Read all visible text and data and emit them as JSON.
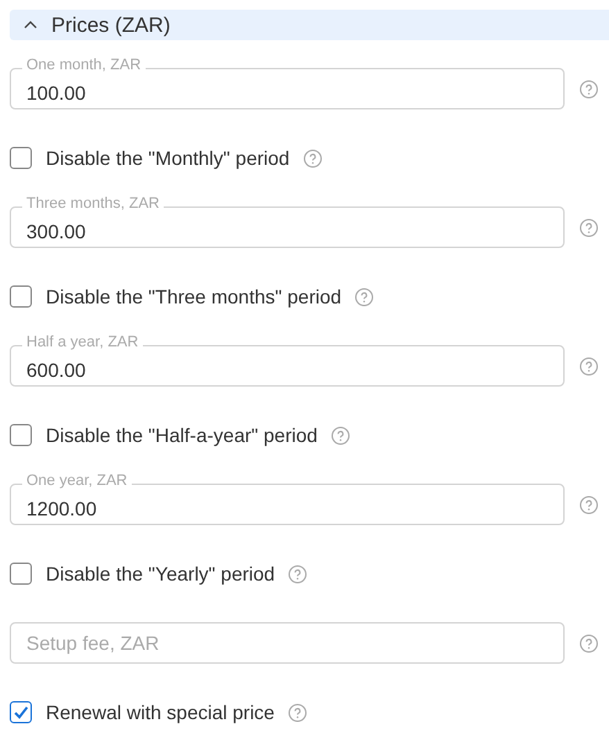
{
  "section": {
    "title": "Prices (ZAR)",
    "expanded": true
  },
  "items": [
    {
      "kind": "field",
      "label": "One month, ZAR",
      "value": "100.00"
    },
    {
      "kind": "checkbox",
      "label": "Disable the \"Monthly\" period",
      "checked": false
    },
    {
      "kind": "field",
      "label": "Three months, ZAR",
      "value": "300.00"
    },
    {
      "kind": "checkbox",
      "label": "Disable the \"Three months\" period",
      "checked": false
    },
    {
      "kind": "field",
      "label": "Half a year, ZAR",
      "value": "600.00"
    },
    {
      "kind": "checkbox",
      "label": "Disable the \"Half-a-year\" period",
      "checked": false
    },
    {
      "kind": "field",
      "label": "One year, ZAR",
      "value": "1200.00"
    },
    {
      "kind": "checkbox",
      "label": "Disable the \"Yearly\" period",
      "checked": false
    },
    {
      "kind": "field",
      "placeholder": "Setup fee, ZAR"
    },
    {
      "kind": "checkbox",
      "label": "Renewal with special price",
      "checked": true
    }
  ]
}
